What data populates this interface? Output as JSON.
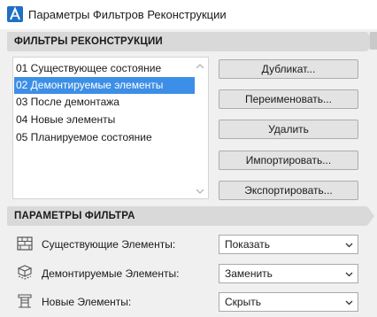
{
  "window": {
    "title": "Параметры Фильтров Реконструкции"
  },
  "filters_section": {
    "header": "ФИЛЬТРЫ РЕКОНСТРУКЦИИ",
    "items": [
      {
        "label": "01 Существующее состояние",
        "selected": false
      },
      {
        "label": "02 Демонтируемые элементы",
        "selected": true
      },
      {
        "label": "03 После демонтажа",
        "selected": false
      },
      {
        "label": "04 Новые элементы",
        "selected": false
      },
      {
        "label": "05 Планируемое состояние",
        "selected": false
      }
    ],
    "buttons": {
      "duplicate": "Дубликат...",
      "rename": "Переименовать...",
      "delete": "Удалить",
      "import": "Импортировать...",
      "export": "Экспортировать..."
    }
  },
  "params_section": {
    "header": "ПАРАМЕТРЫ ФИЛЬТРА",
    "rows": [
      {
        "label": "Существующие Элементы:",
        "value": "Показать",
        "icon": "existing-elements-icon"
      },
      {
        "label": "Демонтируемые Элементы:",
        "value": "Заменить",
        "icon": "demolished-elements-icon"
      },
      {
        "label": "Новые Элементы:",
        "value": "Скрыть",
        "icon": "new-elements-icon"
      }
    ]
  },
  "colors": {
    "selection": "#3d8ee6",
    "header_bg": "#d9d9d9",
    "window_bg": "#f0f0f0"
  }
}
